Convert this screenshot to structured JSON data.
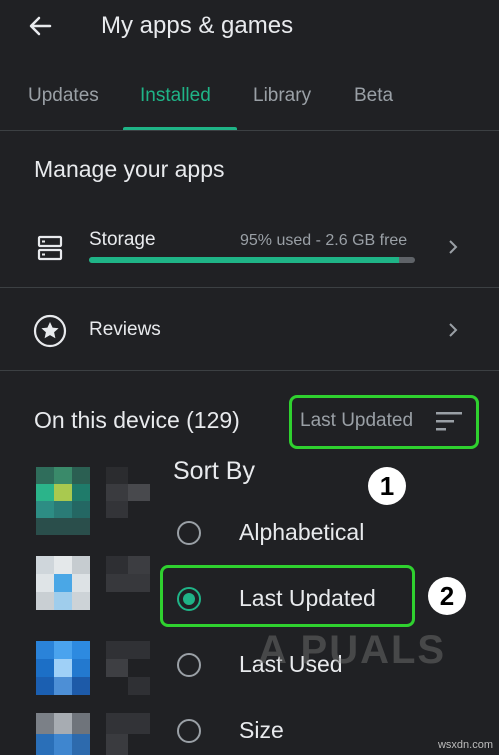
{
  "header": {
    "title": "My apps & games",
    "back_icon": "arrow-left-icon"
  },
  "tabs": [
    {
      "label": "Updates",
      "active": false
    },
    {
      "label": "Installed",
      "active": true
    },
    {
      "label": "Library",
      "active": false
    },
    {
      "label": "Beta",
      "active": false
    }
  ],
  "manage": {
    "title": "Manage your apps",
    "storage": {
      "label": "Storage",
      "meta": "95% used - 2.6 GB free",
      "used_fraction": 0.95
    },
    "reviews": {
      "label": "Reviews"
    }
  },
  "device": {
    "title": "On this device (129)",
    "sort_label": "Last Updated"
  },
  "sort_menu": {
    "title": "Sort By",
    "options": [
      {
        "label": "Alphabetical",
        "checked": false
      },
      {
        "label": "Last Updated",
        "checked": true
      },
      {
        "label": "Last Used",
        "checked": false
      },
      {
        "label": "Size",
        "checked": false
      }
    ]
  },
  "annotations": {
    "step1": "1",
    "step2": "2"
  },
  "watermark": "A  PUALS",
  "credit": "wsxdn.com",
  "colors": {
    "accent": "#1fb487",
    "highlight": "#2fd12f",
    "background": "#202124"
  }
}
